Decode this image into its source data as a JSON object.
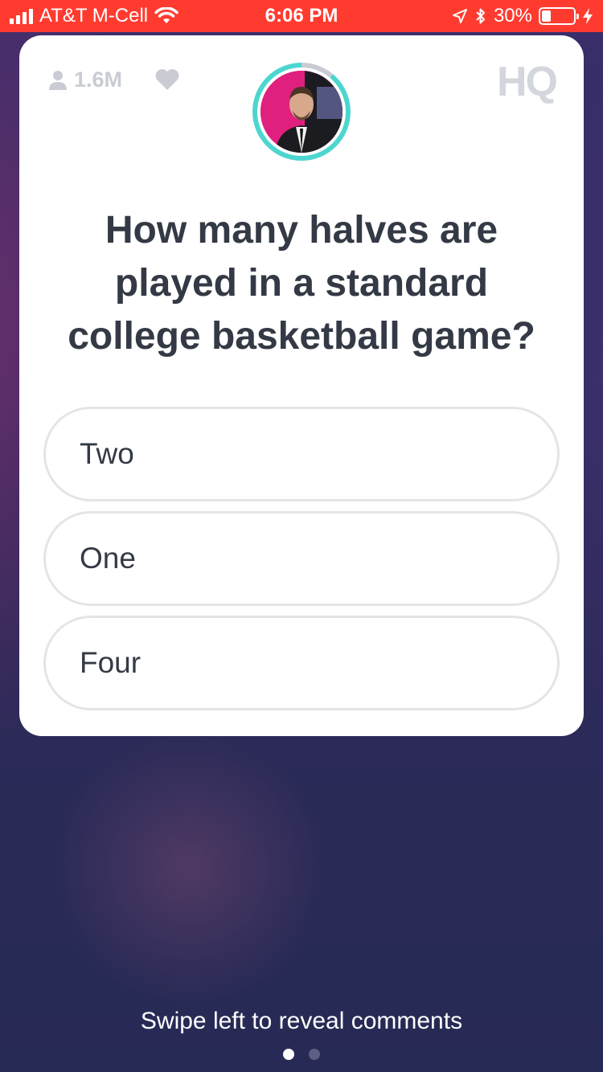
{
  "status_bar": {
    "carrier": "AT&T M-Cell",
    "time": "6:06 PM",
    "battery": "30%",
    "battery_level": 0.3,
    "status_color": "#ff3b30"
  },
  "card": {
    "viewer_count": "1.6M",
    "logo": "HQ",
    "question": "How many halves are played in a standard college basketball game?",
    "timer_remaining_fraction": 0.89,
    "timer_color": "#4cd6cf",
    "answers": [
      {
        "label": "Two"
      },
      {
        "label": "One"
      },
      {
        "label": "Four"
      }
    ]
  },
  "footer": {
    "hint": "Swipe left to reveal comments",
    "pages": 2,
    "active_page": 1
  },
  "icons": {
    "viewers": "person-icon",
    "like": "heart-icon",
    "wifi": "wifi-icon",
    "location": "location-arrow-icon",
    "bluetooth": "bluetooth-icon",
    "charging": "bolt-icon"
  }
}
